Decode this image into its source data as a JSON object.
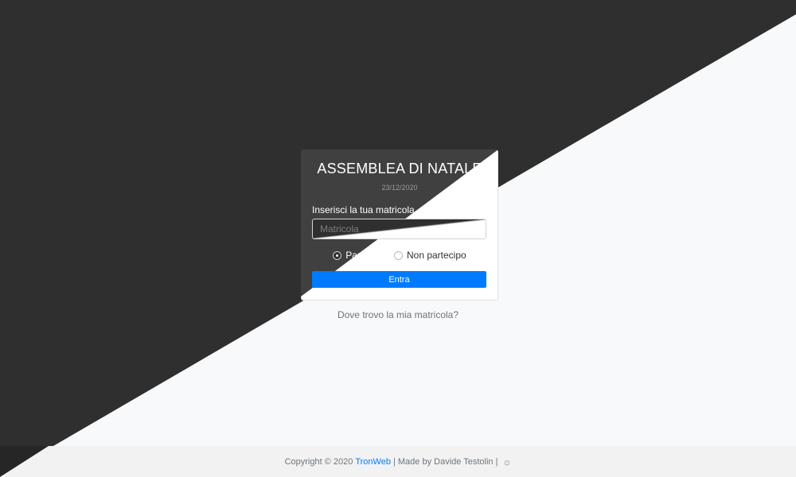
{
  "card": {
    "title": "ASSEMBLEA DI NATALE",
    "date": "23/12/2020",
    "field_label": "Inserisci la tua matricola",
    "field_placeholder": "Matricola",
    "field_value": "",
    "radio_options": [
      {
        "label": "Partecipo",
        "checked": true
      },
      {
        "label": "Non partecipo",
        "checked": false
      }
    ],
    "submit_label": "Entra"
  },
  "help_link": "Dove trovo la mia matricola?",
  "footer": {
    "copyright": "Copyright © 2020",
    "brand": "TronWeb",
    "made_by": "| Made by Davide Testolin |",
    "theme_toggle_icon": "sun-icon"
  },
  "colors": {
    "dark_bg": "#2f2f2f",
    "light_bg": "#f8f9fa",
    "accent": "#007bff"
  }
}
